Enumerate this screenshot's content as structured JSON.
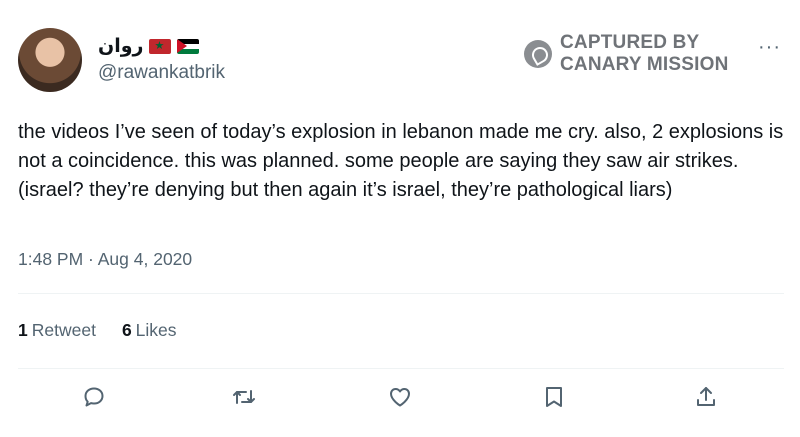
{
  "user": {
    "display_name": "روان",
    "handle": "@rawankatbrik",
    "flags": [
      "morocco-flag",
      "palestine-flag"
    ]
  },
  "watermark": {
    "line1": "CAPTURED BY",
    "line2": "CANARY MISSION"
  },
  "more_label": "···",
  "tweet": {
    "text": "the videos I’ve seen of today’s explosion in lebanon made me cry. also, 2 explosions is not a coincidence. this was planned. some people are saying they saw air strikes. (israel? they’re denying but then again it’s israel, they’re pathological liars)",
    "timestamp": "1:48 PM · Aug 4, 2020"
  },
  "stats": {
    "retweets_count": "1",
    "retweets_label": "Retweet",
    "likes_count": "6",
    "likes_label": "Likes"
  },
  "actions": [
    "reply-icon",
    "retweet-icon",
    "like-icon",
    "bookmark-icon",
    "share-icon"
  ],
  "colors": {
    "text": "#0f1419",
    "secondary": "#536471",
    "divider": "#eff3f4"
  }
}
